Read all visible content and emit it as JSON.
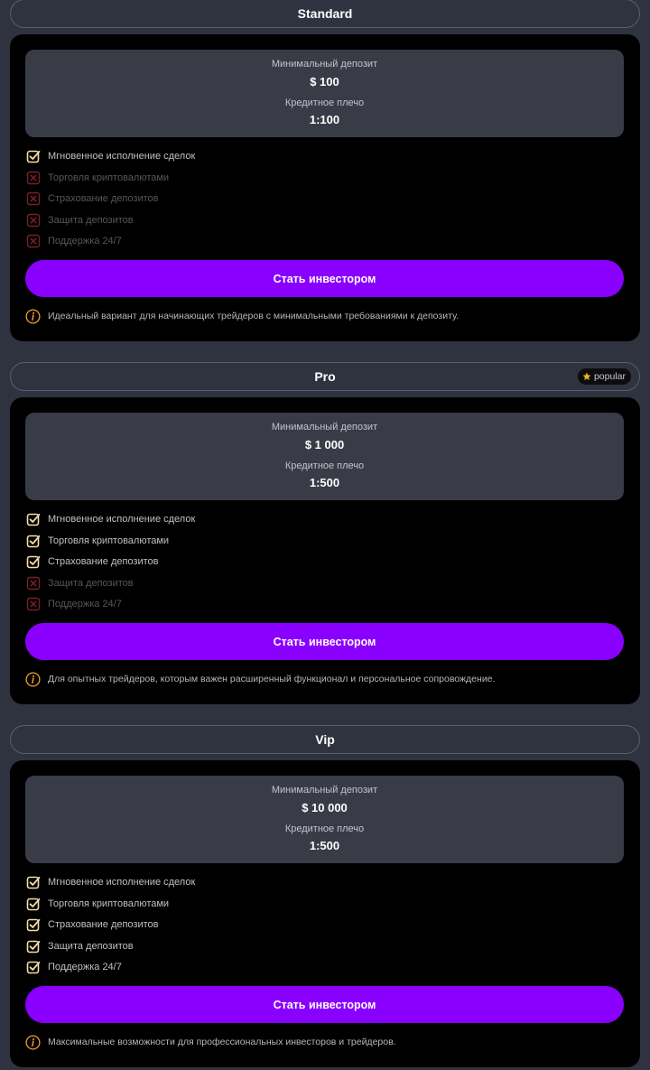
{
  "colors": {
    "accent": "#8a00ff",
    "check": "#f2dfa8",
    "cross": "#7a1f2a",
    "info": "#f0a030"
  },
  "common": {
    "min_deposit_label": "Минимальный депозит",
    "leverage_label": "Кредитное плечо",
    "button_label": "Стать инвестором"
  },
  "plans": [
    {
      "name": "Standard",
      "deposit": "$ 100",
      "leverage": "1:100",
      "features": [
        {
          "label": "Мгновенное исполнение сделок",
          "enabled": true
        },
        {
          "label": "Торговля криптовалютами",
          "enabled": false
        },
        {
          "label": "Страхование депозитов",
          "enabled": false
        },
        {
          "label": "Защита депозитов",
          "enabled": false
        },
        {
          "label": "Поддержка 24/7",
          "enabled": false
        }
      ],
      "note": "Идеальный вариант для начинающих трейдеров с минимальными требованиями к депозиту."
    },
    {
      "name": "Pro",
      "badge": "popular",
      "badge_icon": "star-icon",
      "deposit": "$ 1 000",
      "leverage": "1:500",
      "features": [
        {
          "label": "Мгновенное исполнение сделок",
          "enabled": true
        },
        {
          "label": "Торговля криптовалютами",
          "enabled": true
        },
        {
          "label": "Страхование депозитов",
          "enabled": true
        },
        {
          "label": "Защита депозитов",
          "enabled": false
        },
        {
          "label": "Поддержка 24/7",
          "enabled": false
        }
      ],
      "note": "Для опытных трейдеров, которым важен расширенный функционал и персональное сопровождение."
    },
    {
      "name": "Vip",
      "deposit": "$ 10 000",
      "leverage": "1:500",
      "features": [
        {
          "label": "Мгновенное исполнение сделок",
          "enabled": true
        },
        {
          "label": "Торговля криптовалютами",
          "enabled": true
        },
        {
          "label": "Страхование депозитов",
          "enabled": true
        },
        {
          "label": "Защита депозитов",
          "enabled": true
        },
        {
          "label": "Поддержка 24/7",
          "enabled": true
        }
      ],
      "note": "Максимальные возможности для профессиональных инвесторов и трейдеров."
    }
  ]
}
